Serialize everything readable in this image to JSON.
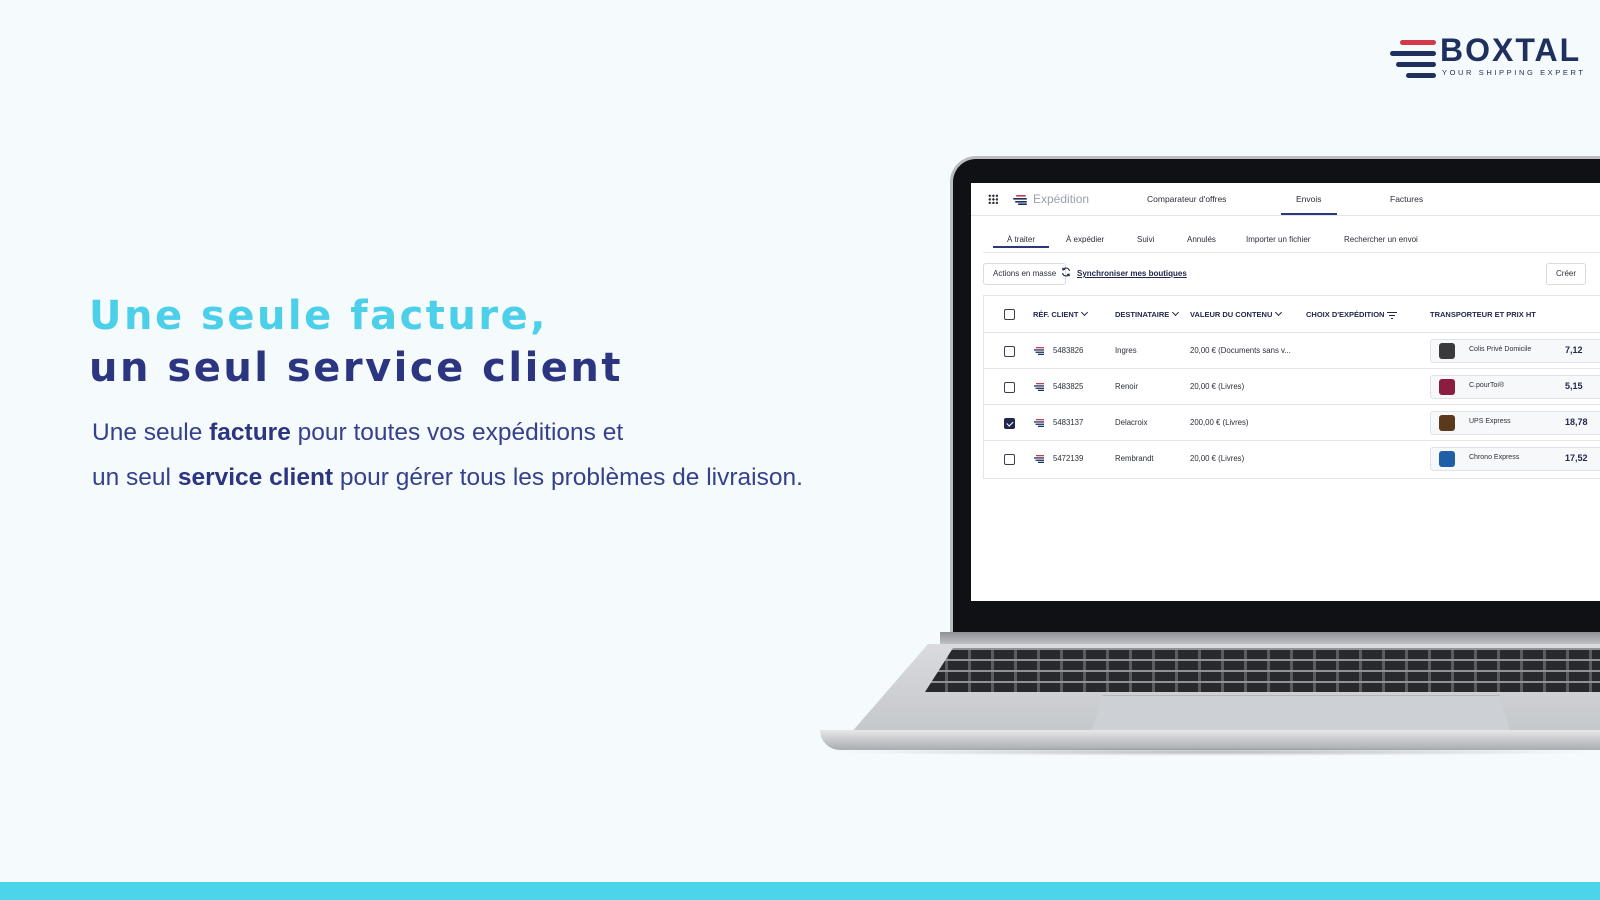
{
  "brand": {
    "name": "BOXTAL",
    "tagline": "YOUR SHIPPING EXPERT",
    "colors": {
      "navy": "#20305e",
      "cyan": "#4ccfe9",
      "red": "#d23a4a",
      "indigo": "#2c3580"
    }
  },
  "hero": {
    "headline_line1": "Une seule facture,",
    "headline_line2": "un seul service client",
    "sub_line1_a": "Une seule ",
    "sub_line1_b": "facture",
    "sub_line1_c": " pour toutes vos expéditions et",
    "sub_line2_a": "un seul ",
    "sub_line2_b": "service client",
    "sub_line2_c": " pour gérer tous les problèmes de livraison."
  },
  "app": {
    "grid_icon": "apps-grid-icon",
    "app_name": "Expédition",
    "top_tabs": [
      {
        "label": "Comparateur d'offres",
        "active": false
      },
      {
        "label": "Envois",
        "active": true
      },
      {
        "label": "Factures",
        "active": false
      }
    ],
    "sub_tabs": [
      {
        "label": "À traiter",
        "active": true
      },
      {
        "label": "À expédier",
        "active": false
      },
      {
        "label": "Suivi",
        "active": false
      },
      {
        "label": "Annulés",
        "active": false
      },
      {
        "label": "Importer un fichier",
        "active": false
      },
      {
        "label": "Rechercher un envoi",
        "active": false
      }
    ],
    "toolbar": {
      "mass_actions": "Actions en masse",
      "sync": "Synchroniser mes boutiques",
      "create": "Créer"
    },
    "table": {
      "headers": {
        "ref": "RÉF. CLIENT",
        "recipient": "DESTINATAIRE",
        "value": "VALEUR DU CONTENU",
        "shipping_choice": "CHOIX D'EXPÉDITION",
        "carrier": "TRANSPORTEUR ET PRIX HT"
      },
      "rows": [
        {
          "ref": "5483826",
          "recipient": "Ingres",
          "value": "20,00 € (Documents sans v...",
          "carrier": "Colis Privé Domicile",
          "price": "7,12",
          "checked": false,
          "carrier_color": "#3a3a3a"
        },
        {
          "ref": "5483825",
          "recipient": "Renoir",
          "value": "20,00 € (Livres)",
          "carrier": "C.pourToi®",
          "price": "5,15",
          "checked": false,
          "carrier_color": "#8c1d40"
        },
        {
          "ref": "5483137",
          "recipient": "Delacroix",
          "value": "200,00 € (Livres)",
          "carrier": "UPS Express",
          "price": "18,78",
          "checked": true,
          "carrier_color": "#5a3a1a"
        },
        {
          "ref": "5472139",
          "recipient": "Rembrandt",
          "value": "20,00 € (Livres)",
          "carrier": "Chrono Express",
          "price": "17,52",
          "checked": false,
          "carrier_color": "#1f5fa8"
        }
      ]
    }
  }
}
